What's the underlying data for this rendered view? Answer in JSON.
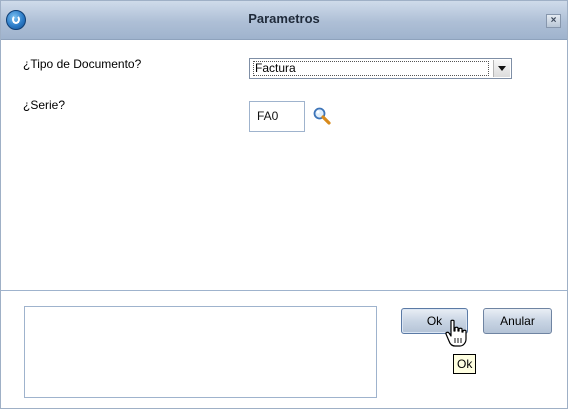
{
  "window": {
    "title": "Parametros",
    "close_label": "×"
  },
  "form": {
    "tipo_label": "¿Tipo de Documento?",
    "tipo_value": "Factura",
    "serie_label": "¿Serie?",
    "serie_value": "FA0"
  },
  "buttons": {
    "ok_label": "Ok",
    "anular_label": "Anular"
  },
  "tooltip": {
    "text": "Ok"
  },
  "colors": {
    "titlebar": "#aebfd6",
    "border": "#9fb3cd",
    "tooltip_bg": "#ffffe1"
  },
  "icons": {
    "app": "app-logo-icon",
    "search": "search-icon",
    "cursor": "hand-cursor-icon"
  }
}
